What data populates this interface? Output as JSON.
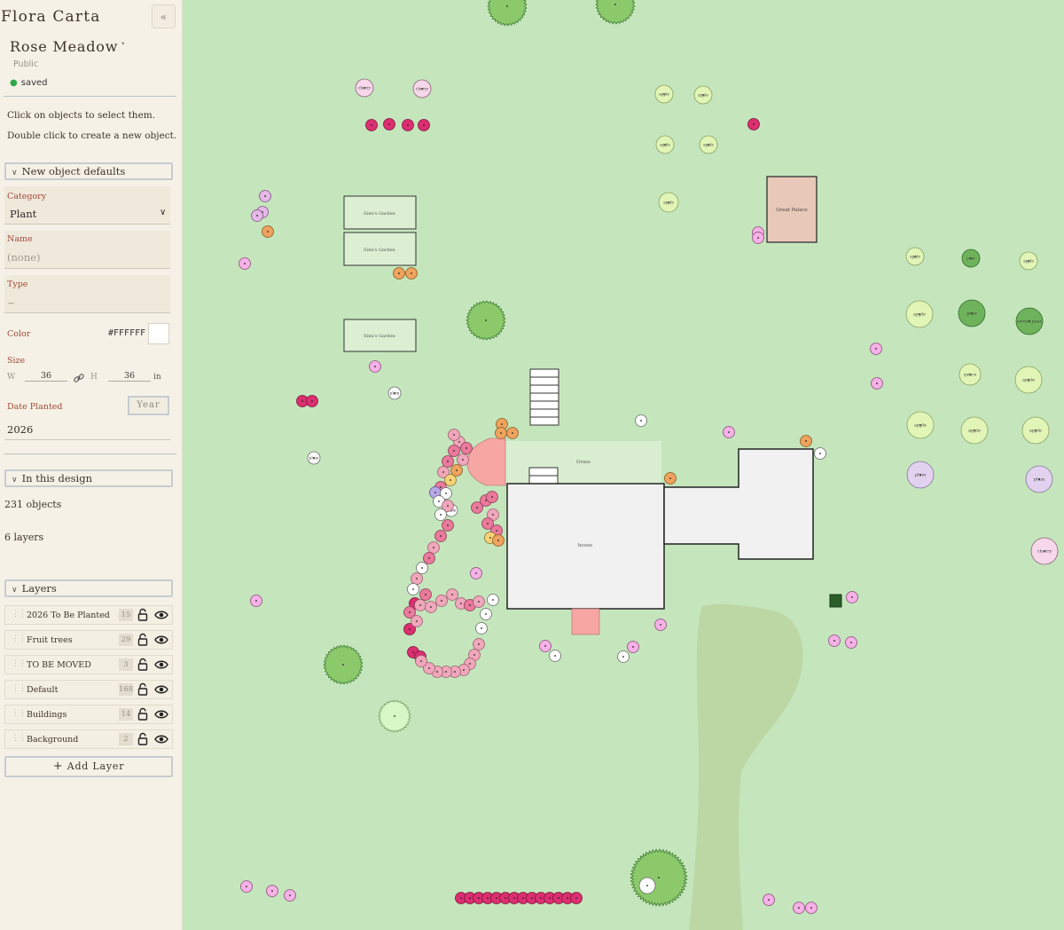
{
  "app": {
    "title": "Flora Carta",
    "collapse_label": "«"
  },
  "design": {
    "name": "Rose Meadow",
    "visibility": "Public",
    "status": "saved"
  },
  "help": {
    "line1": "Click on objects to select them.",
    "line2": "Double click to create a new object."
  },
  "defaults": {
    "header": "New object defaults",
    "category_label": "Category",
    "category_value": "Plant",
    "name_label": "Name",
    "name_placeholder": "(none)",
    "type_label": "Type",
    "type_placeholder": "~",
    "color_label": "Color",
    "color_value": "#FFFFFF",
    "size_label": "Size",
    "width_label": "W",
    "width_value": "36",
    "height_label": "H",
    "height_value": "36",
    "unit": "in",
    "date_label": "Date Planted",
    "year_button": "Year",
    "date_value": "2026"
  },
  "in_design": {
    "header": "In this design",
    "objects": "231 objects",
    "layers": "6 layers"
  },
  "layers": {
    "header": "Layers",
    "items": [
      {
        "name": "2026 To Be Planted",
        "count": "15"
      },
      {
        "name": "Fruit trees",
        "count": "29"
      },
      {
        "name": "TO BE MOVED",
        "count": "3"
      },
      {
        "name": "Default",
        "count": "168"
      },
      {
        "name": "Buildings",
        "count": "14"
      },
      {
        "name": "Background",
        "count": "2"
      }
    ],
    "add_label": "Add Layer"
  },
  "map": {
    "labels": {
      "house": "house",
      "grass": "Grass",
      "great_palace": "Great Palace",
      "simi_garden": "Simi's Garden",
      "cherry": "cherry",
      "apple": "apple",
      "pear": "pear",
      "plum": "plum",
      "quince": "quince",
      "sweet_pear": "sweet pear"
    }
  }
}
